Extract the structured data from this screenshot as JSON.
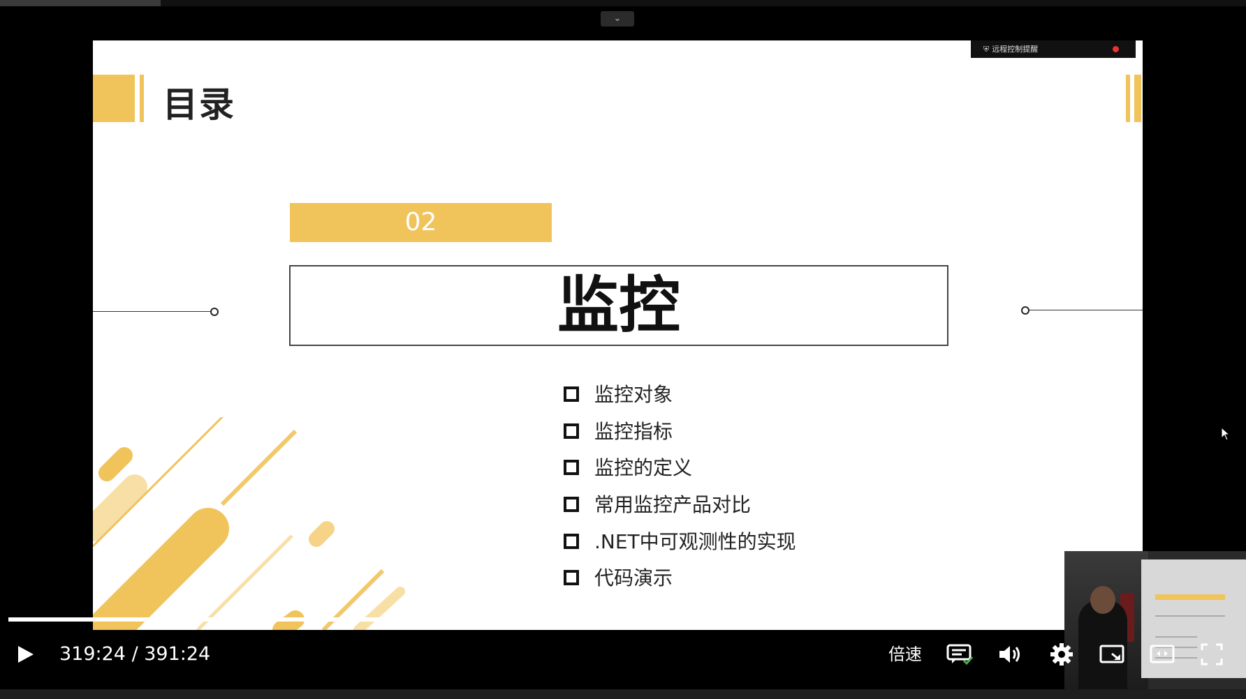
{
  "slide": {
    "title": "目录",
    "remote_notice": "远程控制提醒",
    "section_number": "02",
    "section_heading": "监控",
    "items": [
      "监控对象",
      "监控指标",
      "监控的定义",
      "常用监控产品对比",
      ".NET中可观测性的实现",
      "代码演示"
    ]
  },
  "player": {
    "time_display": "319:24 / 391:24",
    "current_time": "319:24",
    "duration": "391:24",
    "progress_fraction": 0.817,
    "speed_label": "倍速",
    "icons": [
      "collapse-chevron-icon",
      "play-icon",
      "danmaku-icon",
      "volume-icon",
      "settings-icon",
      "pip-icon",
      "widescreen-icon",
      "fullscreen-icon"
    ]
  },
  "colors": {
    "accent": "#f0c35b",
    "background": "#000000",
    "slide_bg": "#ffffff"
  }
}
